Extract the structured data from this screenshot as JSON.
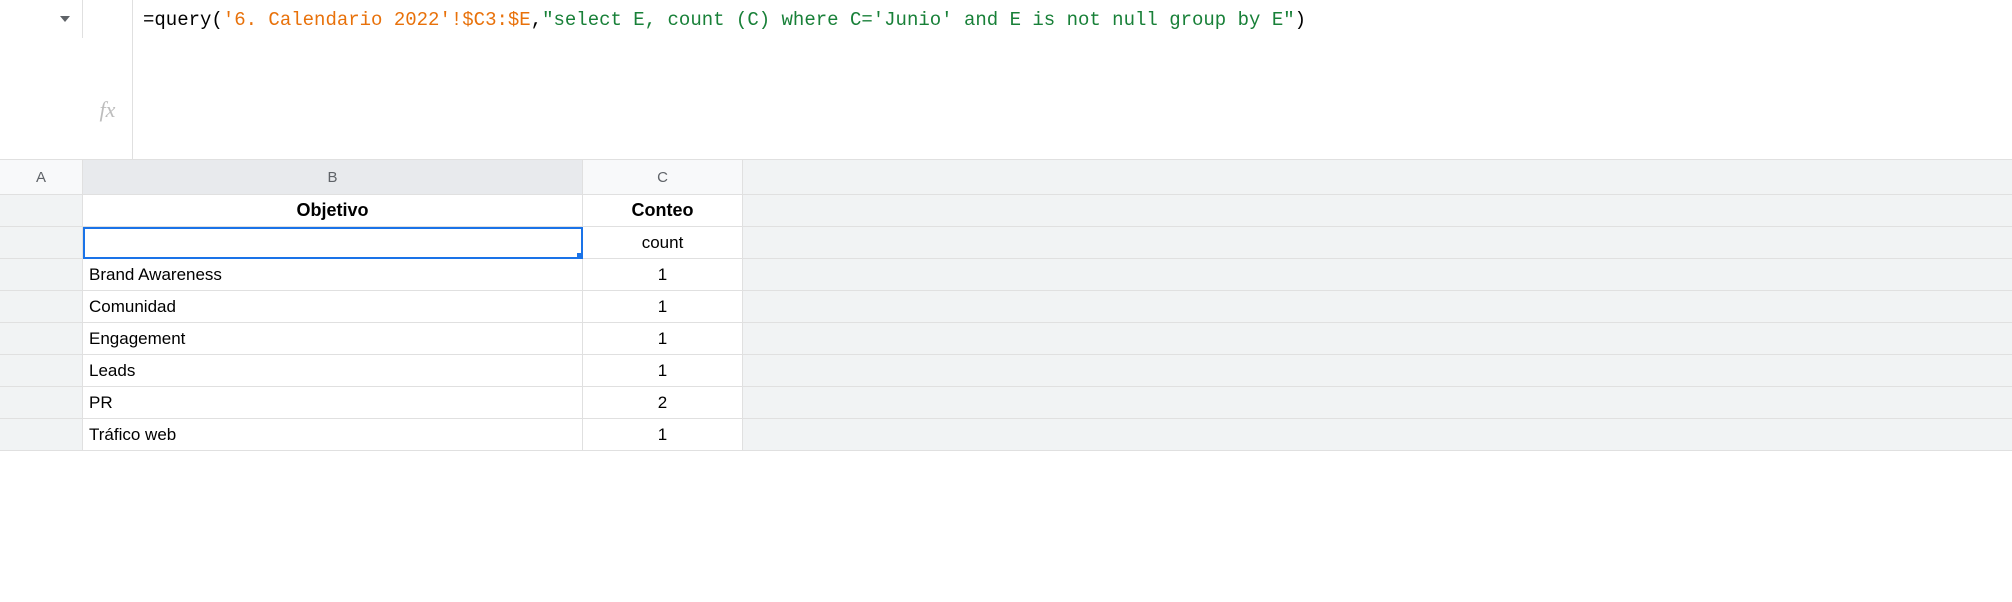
{
  "formula": {
    "eq": "=",
    "func": "query",
    "open": "(",
    "range": "'6. Calendario 2022'!$C3:$E",
    "comma": ",",
    "query_string": "\"select E, count (C) where C='Junio' and E is not null group by E\"",
    "close": ")"
  },
  "fx_label": "fx",
  "columns": {
    "a": "A",
    "b": "B",
    "c": "C"
  },
  "headers": {
    "objetivo": "Objetivo",
    "conteo": "Conteo"
  },
  "rows": [
    {
      "b": "",
      "c": "count"
    },
    {
      "b": "Brand Awareness",
      "c": "1"
    },
    {
      "b": "Comunidad",
      "c": "1"
    },
    {
      "b": "Engagement",
      "c": "1"
    },
    {
      "b": "Leads",
      "c": "1"
    },
    {
      "b": "PR",
      "c": "2"
    },
    {
      "b": "Tráfico web",
      "c": "1"
    }
  ]
}
